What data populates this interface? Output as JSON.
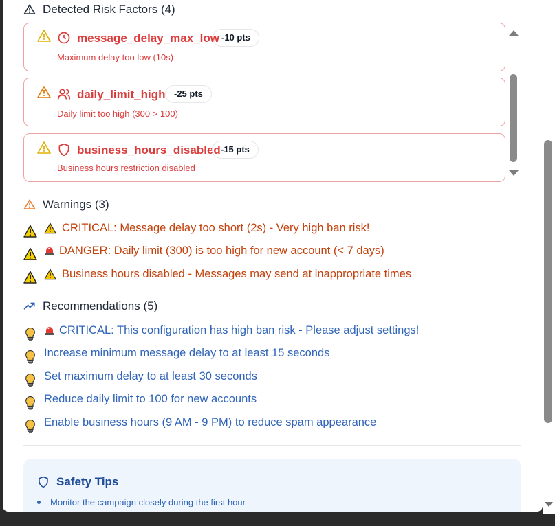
{
  "risk_section": {
    "title": "Detected Risk Factors (4)",
    "items": [
      {
        "name": "message_delay_max_low",
        "pts": "-10 pts",
        "desc": "Maximum delay too low (10s)",
        "icon": "clock-icon"
      },
      {
        "name": "daily_limit_high",
        "pts": "-25 pts",
        "desc": "Daily limit too high (300 > 100)",
        "icon": "users-icon"
      },
      {
        "name": "business_hours_disabled",
        "pts": "-15 pts",
        "desc": "Business hours restriction disabled",
        "icon": "shield-icon"
      }
    ]
  },
  "warnings": {
    "title": "Warnings (3)",
    "items": [
      {
        "prefix": "warning-emoji",
        "text": "CRITICAL: Message delay too short (2s) - Very high ban risk!"
      },
      {
        "prefix": "siren-emoji",
        "text": "DANGER: Daily limit (300) is too high for new account (< 7 days)"
      },
      {
        "prefix": "warning-emoji",
        "text": "Business hours disabled - Messages may send at inappropriate times"
      }
    ]
  },
  "recommendations": {
    "title": "Recommendations (5)",
    "items": [
      {
        "prefix": "siren-emoji",
        "text": "CRITICAL: This configuration has high ban risk - Please adjust settings!"
      },
      {
        "prefix": "",
        "text": "Increase minimum message delay to at least 15 seconds"
      },
      {
        "prefix": "",
        "text": "Set maximum delay to at least 30 seconds"
      },
      {
        "prefix": "",
        "text": "Reduce daily limit to 100 for new accounts"
      },
      {
        "prefix": "",
        "text": "Enable business hours (9 AM - 9 PM) to reduce spam appearance"
      }
    ]
  },
  "safety_tips": {
    "title": "Safety Tips",
    "items": [
      "Monitor the campaign closely during the first hour"
    ]
  },
  "colors": {
    "danger": "#dc3b3b",
    "warning": "#c2410c",
    "info": "#2f64b8",
    "tips_bg": "#eef5fd"
  }
}
